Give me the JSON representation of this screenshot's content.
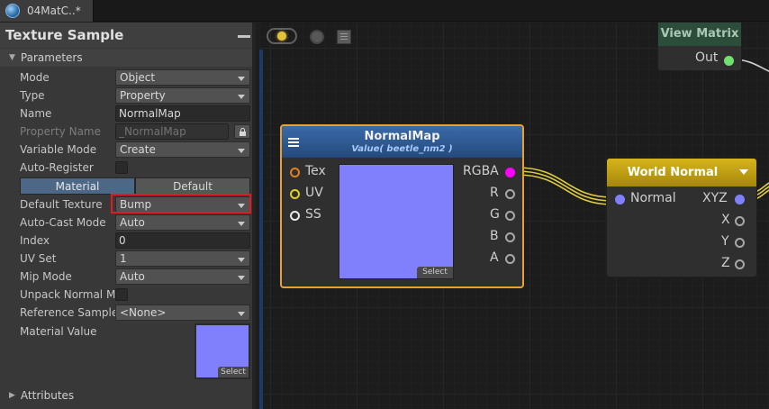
{
  "tab": {
    "title": "04MatC..*",
    "icon": "globe-icon"
  },
  "inspector": {
    "title": "Texture Sample",
    "parameters_label": "Parameters",
    "attributes_label": "Attributes",
    "fields": {
      "mode": {
        "label": "Mode",
        "value": "Object"
      },
      "type": {
        "label": "Type",
        "value": "Property"
      },
      "name": {
        "label": "Name",
        "value": "NormalMap"
      },
      "property_name": {
        "label": "Property Name",
        "value": "_NormalMap"
      },
      "variable_mode": {
        "label": "Variable Mode",
        "value": "Create"
      },
      "auto_register": {
        "label": "Auto-Register"
      },
      "material_tab": "Material",
      "default_tab": "Default",
      "default_texture": {
        "label": "Default Texture",
        "value": "Bump"
      },
      "auto_cast_mode": {
        "label": "Auto-Cast Mode",
        "value": "Auto"
      },
      "index": {
        "label": "Index",
        "value": "0"
      },
      "uv_set": {
        "label": "UV Set",
        "value": "1"
      },
      "mip_mode": {
        "label": "Mip Mode",
        "value": "Auto"
      },
      "unpack_normal_map": {
        "label": "Unpack Normal Map"
      },
      "reference_sampler": {
        "label": "Reference Sampler",
        "value": "<None>"
      },
      "material_value": {
        "label": "Material Value",
        "select_label": "Select"
      }
    }
  },
  "graph": {
    "normalmap_node": {
      "title": "NormalMap",
      "subtitle": "Value( beetle_nm2 )",
      "inputs": [
        "Tex",
        "UV",
        "SS"
      ],
      "outputs": [
        "RGBA",
        "R",
        "G",
        "B",
        "A"
      ],
      "select_label": "Select",
      "preview_color": "#8080fd"
    },
    "worldnormal_node": {
      "title": "World Normal",
      "input": "Normal",
      "outputs": [
        "XYZ",
        "X",
        "Y",
        "Z"
      ]
    },
    "viewmatrix_node": {
      "title": "View Matrix",
      "output": "Out"
    }
  },
  "colors": {
    "accent_selected": "#e8a12c",
    "highlight_box": "#e01b24",
    "rgba_port": "#ff00ff",
    "normal_port": "#8080ff",
    "out_port": "#70e070",
    "wire": "#e0cc40"
  }
}
